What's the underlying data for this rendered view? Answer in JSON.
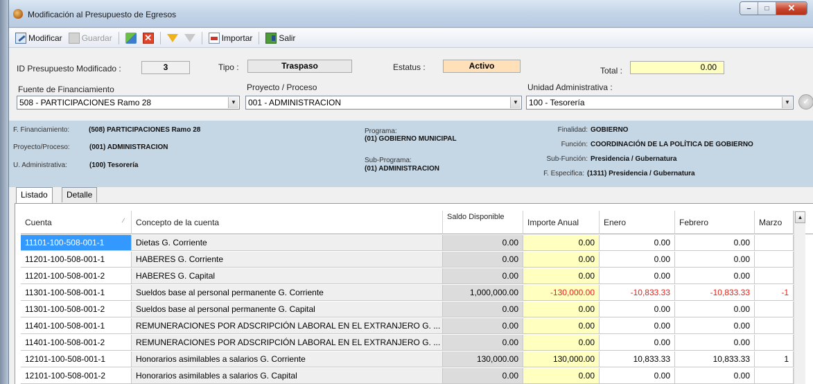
{
  "window": {
    "title": "Modificación al Presupuesto de Egresos",
    "minimize_glyph": "‒",
    "maximize_glyph": "□",
    "close_glyph": "✕"
  },
  "toolbar": {
    "modificar": "Modificar",
    "guardar": "Guardar",
    "importar": "Importar",
    "salir": "Salir",
    "cancel_glyph": "✕"
  },
  "header": {
    "id_label": "ID Presupuesto Modificado :",
    "id_value": "3",
    "tipo_label": "Tipo :",
    "tipo_value": "Traspaso",
    "estatus_label": "Estatus :",
    "estatus_value": "Activo",
    "total_label": "Total :",
    "total_value": "0.00",
    "fuente_label": "Fuente de Financiamiento",
    "fuente_value": "508 - PARTICIPACIONES Ramo 28",
    "proyecto_label": "Proyecto / Proceso",
    "proyecto_value": "001 - ADMINISTRACION",
    "unidad_label": "Unidad Administrativa :",
    "unidad_value": "100 - Tesorería",
    "ok_glyph": "✓"
  },
  "summary": {
    "ff_label": "F. Financiamiento:",
    "ff_value": "(508) PARTICIPACIONES Ramo 28",
    "pp_label": "Proyecto/Proceso:",
    "pp_value": "(001) ADMINISTRACION",
    "ua_label": "U. Administrativa:",
    "ua_value": "(100) Tesorería",
    "programa_label": "Programa:",
    "programa_value": "(01) GOBIERNO MUNICIPAL",
    "subprograma_label": "Sub-Programa:",
    "subprograma_value": "(01) ADMINISTRACION",
    "finalidad_label": "Finalidad:",
    "finalidad_value": "GOBIERNO",
    "funcion_label": "Función:",
    "funcion_value": "COORDINACIÓN DE LA POLÍTICA DE GOBIERNO",
    "subfuncion_label": "Sub-Función:",
    "subfuncion_value": "Presidencia / Gubernatura",
    "fespecifica_label": "F. Especifica:",
    "fespecifica_value": "(1311) Presidencia / Gubernatura"
  },
  "tabs": [
    "Listado",
    "Detalle"
  ],
  "grid": {
    "columns": {
      "cuenta": "Cuenta",
      "concepto": "Concepto de la cuenta",
      "saldo": "Saldo Disponible",
      "importe": "Importe Anual",
      "enero": "Enero",
      "febrero": "Febrero",
      "marzo": "Marzo"
    },
    "sort_glyph": "∕",
    "scroll_up_glyph": "▲",
    "rows": [
      {
        "cuenta": "11101-100-508-001-1",
        "concepto": "Dietas G. Corriente",
        "saldo": "0.00",
        "importe": "0.00",
        "enero": "0.00",
        "febrero": "0.00",
        "marzo": ""
      },
      {
        "cuenta": "11201-100-508-001-1",
        "concepto": "HABERES G. Corriente",
        "saldo": "0.00",
        "importe": "0.00",
        "enero": "0.00",
        "febrero": "0.00",
        "marzo": ""
      },
      {
        "cuenta": "11201-100-508-001-2",
        "concepto": "HABERES G. Capital",
        "saldo": "0.00",
        "importe": "0.00",
        "enero": "0.00",
        "febrero": "0.00",
        "marzo": ""
      },
      {
        "cuenta": "11301-100-508-001-1",
        "concepto": "Sueldos base al personal permanente G. Corriente",
        "saldo": "1,000,000.00",
        "importe": "-130,000.00",
        "enero": "-10,833.33",
        "febrero": "-10,833.33",
        "marzo": "-1"
      },
      {
        "cuenta": "11301-100-508-001-2",
        "concepto": "Sueldos base al personal permanente G. Capital",
        "saldo": "0.00",
        "importe": "0.00",
        "enero": "0.00",
        "febrero": "0.00",
        "marzo": ""
      },
      {
        "cuenta": "11401-100-508-001-1",
        "concepto": "REMUNERACIONES POR ADSCRIPCIÓN LABORAL EN EL EXTRANJERO G. ...",
        "saldo": "0.00",
        "importe": "0.00",
        "enero": "0.00",
        "febrero": "0.00",
        "marzo": ""
      },
      {
        "cuenta": "11401-100-508-001-2",
        "concepto": "REMUNERACIONES POR ADSCRIPCIÓN LABORAL EN EL EXTRANJERO G. ...",
        "saldo": "0.00",
        "importe": "0.00",
        "enero": "0.00",
        "febrero": "0.00",
        "marzo": ""
      },
      {
        "cuenta": "12101-100-508-001-1",
        "concepto": "Honorarios asimilables a salarios G. Corriente",
        "saldo": "130,000.00",
        "importe": "130,000.00",
        "enero": "10,833.33",
        "febrero": "10,833.33",
        "marzo": "1"
      },
      {
        "cuenta": "12101-100-508-001-2",
        "concepto": "Honorarios asimilables a salarios G. Capital",
        "saldo": "0.00",
        "importe": "0.00",
        "enero": "0.00",
        "febrero": "0.00",
        "marzo": ""
      }
    ]
  },
  "colors": {
    "selected_row": "#3399ff",
    "importe_bg": "#ffffc0",
    "negative": "#e3231b",
    "status_bg": "#ffe0b8",
    "summary_bg": "#c5d6e4"
  }
}
